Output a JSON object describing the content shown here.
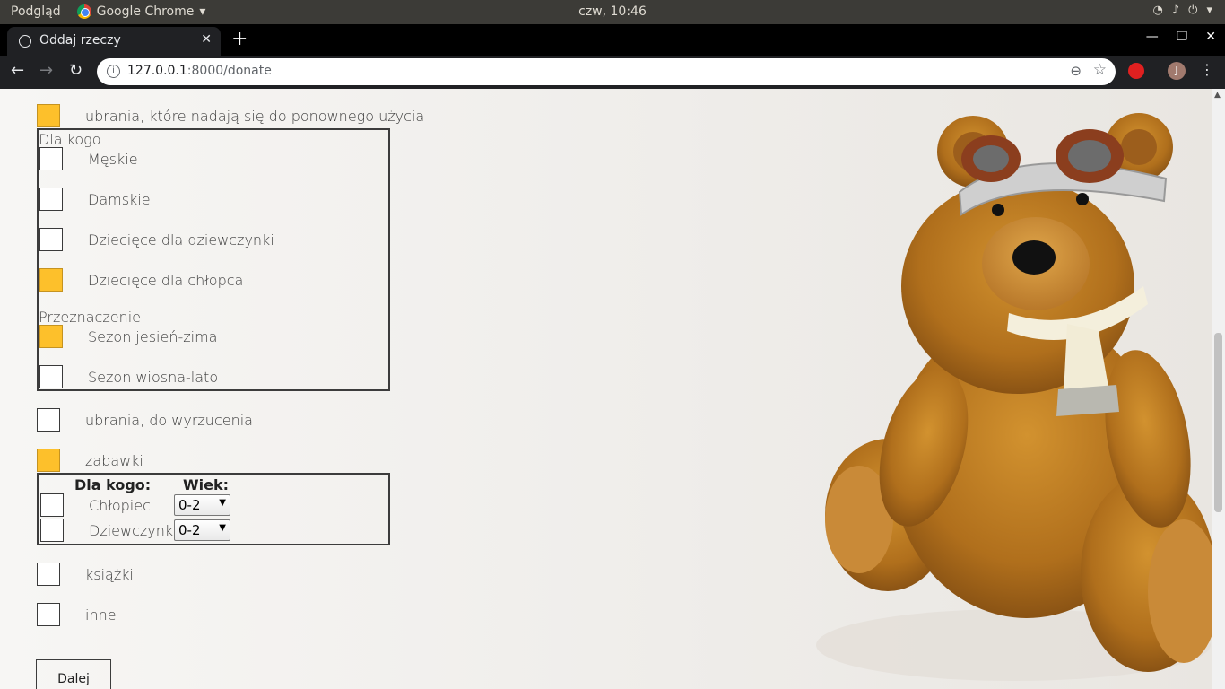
{
  "os_bar": {
    "activities": "Podgląd",
    "app_name": "Google Chrome",
    "clock": "czw, 10:46"
  },
  "browser": {
    "tab_title": "Oddaj rzeczy",
    "url_host": "127.0.0.1",
    "url_path": ":8000/donate",
    "profile_initial": "J"
  },
  "form": {
    "item_reusable": "ubrania, które nadają się do ponownego użycia",
    "for_whom_legend": "Dla kogo",
    "opt_mens": "Męskie",
    "opt_womens": "Damskie",
    "opt_girls": "Dziecięce dla dziewczynki",
    "opt_boys": "Dziecięce dla chłopca",
    "purpose_legend": "Przeznaczenie",
    "opt_autumn_winter": "Sezon jesień-zima",
    "opt_spring_summer": "Sezon wiosna-lato",
    "item_discard": "ubrania, do wyrzucenia",
    "item_toys": "zabawki",
    "toys_for_whom": "Dla kogo:",
    "toys_age": "Wiek:",
    "toys_boy": "Chłopiec",
    "toys_girl": "Dziewczynka",
    "toys_boy_age": "0-2",
    "toys_girl_age": "0-2",
    "item_books": "książki",
    "item_other": "inne",
    "next_button": "Dalej"
  },
  "colors": {
    "checked": "#fdc02b"
  }
}
